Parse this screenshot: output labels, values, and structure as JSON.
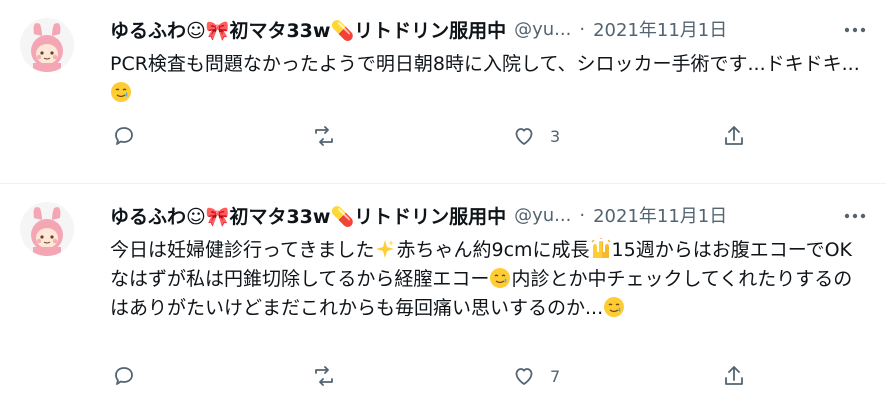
{
  "tweets": [
    {
      "name": "ゆるふわ☺🎀初マタ33w💊リトドリン服用中",
      "handle": "@yu...",
      "date": "2021年11月1日",
      "text_parts": [
        "PCR検査も問題なかったようで明日朝8時に入院して、シロッカー手術です...ドキドキ...",
        ""
      ],
      "likes": "3"
    },
    {
      "name": "ゆるふわ☺🎀初マタ33w💊リトドリン服用中",
      "handle": "@yu...",
      "date": "2021年11月1日",
      "text_parts": [
        "今日は妊婦健診行ってきました",
        "赤ちゃん約9cmに成長",
        "15週からはお腹エコーでOKなはずが私は円錐切除してるから経膣エコー",
        "内診とか中チェックしてくれたりするのはありがたいけどまだこれからも毎回痛い思いするのか...",
        ""
      ],
      "likes": "7"
    }
  ],
  "icons": {
    "reply": "reply-icon",
    "retweet": "retweet-icon",
    "like": "heart-icon",
    "share": "share-icon",
    "more": "more-icon",
    "emoji_tear": "smiling-face-with-tear-emoji",
    "emoji_sparkles": "sparkles-emoji",
    "emoji_hands": "raising-hands-emoji"
  },
  "colors": {
    "text": "#0f1419",
    "secondary": "#536471",
    "divider": "#eff3f4"
  }
}
